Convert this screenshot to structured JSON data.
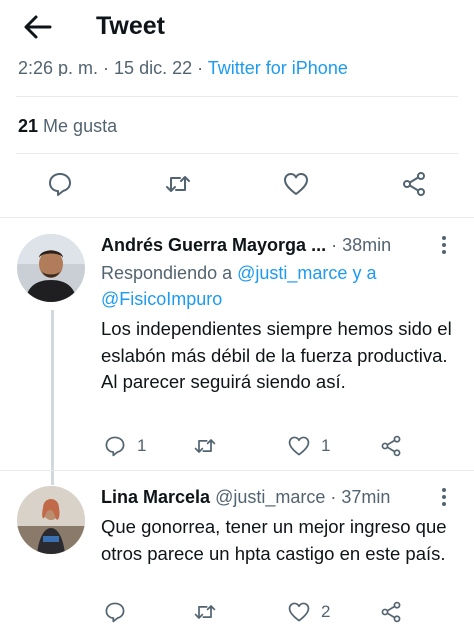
{
  "header": {
    "title": "Tweet"
  },
  "tweet": {
    "time": "2:26 p. m.",
    "date": "15 dic. 22",
    "source": "Twitter for iPhone",
    "like_count": "21",
    "like_label": "Me gusta"
  },
  "replies": [
    {
      "name": "Andrés Guerra Mayorga ...",
      "time": "38min",
      "replying_prefix": "Respondiendo a",
      "mention_1": "@justi_marce",
      "mention_join": "y a",
      "mention_2": "@FisicoImpuro",
      "text": "Los independientes siempre hemos sido el eslabón más débil de la fuerza productiva. Al parecer seguirá siendo así.",
      "reply_count": "1",
      "like_count": "1"
    },
    {
      "name": "Lina Marcela",
      "handle": "@justi_marce",
      "time": "37min",
      "text": "Que gonorrea, tener un mejor ingreso que otros parece un hpta castigo en este país.",
      "like_count": "2"
    }
  ],
  "colors": {
    "accent": "#1d9bf0",
    "secondary_text": "#536471",
    "primary_text": "#0f1419",
    "divider": "#e7e9ea"
  }
}
